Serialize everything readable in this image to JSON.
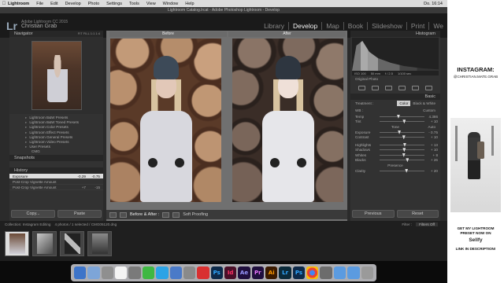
{
  "menubar": {
    "app": "Lightroom",
    "items": [
      "File",
      "Edit",
      "Develop",
      "Photo",
      "Settings",
      "Tools",
      "View",
      "Window",
      "Help"
    ],
    "clock": "Do. 16:14"
  },
  "window": {
    "title": "Lightroom Catalog.lrcat - Adobe Photoshop Lightroom - Develop"
  },
  "identity": {
    "logo": "Lr",
    "product": "Adobe Lightroom CC 2015",
    "user": "Christian Grab"
  },
  "modules": [
    "Library",
    "Develop",
    "Map",
    "Book",
    "Slideshow",
    "Print",
    "We"
  ],
  "left_panel": {
    "navigator": {
      "title": "Navigator",
      "controls": "FIT  FILL  1:1  1:4"
    },
    "presets": [
      "Lightroom B&W Presets",
      "Lightroom B&W Toned Presets",
      "Lightroom Color Presets",
      "Lightroom Effect Presets",
      "Lightroom General Presets",
      "Lightroom Video Presets",
      "User Presets"
    ],
    "user_preset_item": "CMG",
    "snapshots": {
      "title": "Snapshots"
    },
    "history": {
      "title": "History",
      "rows": [
        {
          "label": "Exposure",
          "a": "-0.29",
          "b": "-0.75"
        },
        {
          "label": "Post-Crop Vignette Amount",
          "a": "",
          "b": ""
        },
        {
          "label": "Post-Crop Vignette Amount",
          "a": "+7",
          "b": "-15"
        }
      ]
    },
    "copy_label": "Copy...",
    "paste_label": "Paste"
  },
  "center": {
    "before_label": "Before",
    "after_label": "After",
    "toolbar": {
      "before_after": "Before & After :",
      "soft_proofing": "Soft Proofing"
    }
  },
  "right_panel": {
    "histogram": {
      "title": "Histogram",
      "iso": "ISO 100",
      "focal": "50 mm",
      "aperture": "f / 2.5",
      "shutter": "1/100 sec"
    },
    "original_photo": "Original Photo",
    "basic": {
      "title": "Basic",
      "treatment_label": "Treatment :",
      "treatment_color": "Color",
      "treatment_bw": "Black & White",
      "wb_label": "WB :",
      "wb_value": "Custom",
      "rows": [
        {
          "label": "Temp",
          "value": "4.386",
          "pos": 0.42
        },
        {
          "label": "Tint",
          "value": "+ 10",
          "pos": 0.55
        }
      ],
      "tone_label": "Tone",
      "auto_label": "Auto",
      "tone_rows": [
        {
          "label": "Exposure",
          "value": "- 0.75",
          "pos": 0.44
        },
        {
          "label": "Contrast",
          "value": "+ 10",
          "pos": 0.54
        },
        {
          "label": "Highlights",
          "value": "+ 13",
          "pos": 0.56
        },
        {
          "label": "Shadows",
          "value": "+ 10",
          "pos": 0.55
        },
        {
          "label": "Whites",
          "value": "+ 8",
          "pos": 0.54
        },
        {
          "label": "Blacks",
          "value": "+ 26",
          "pos": 0.62
        }
      ],
      "presence_label": "Presence",
      "presence_rows": [
        {
          "label": "Clarity",
          "value": "+ 20",
          "pos": 0.6
        }
      ]
    },
    "previous_label": "Previous",
    "reset_label": "Reset"
  },
  "filmstrip": {
    "info": "Collection: Instagram Editing",
    "count": "4 photos / 1 selected / CMG05120.dng",
    "filter_label": "Filter :",
    "filter_value": "Filters Off"
  },
  "dock": {
    "apps": [
      "Ps",
      "Id",
      "Ae",
      "Pr",
      "Ai",
      "Lr",
      "Ps"
    ]
  },
  "ad": {
    "heading": "INSTAGRAM:",
    "handle": "@CHRISTIAN.MATE.GRAB",
    "get_line1": "GET MY LIGHTROOM",
    "get_line2": "PRESET NOW ON",
    "sellfy": "Sellfy",
    "link": "LINK IN DESCRIPTION!"
  },
  "colors": {
    "lr_bg": "#2b2b2b",
    "panel": "#323232",
    "active_module": "#f2f2f2"
  }
}
